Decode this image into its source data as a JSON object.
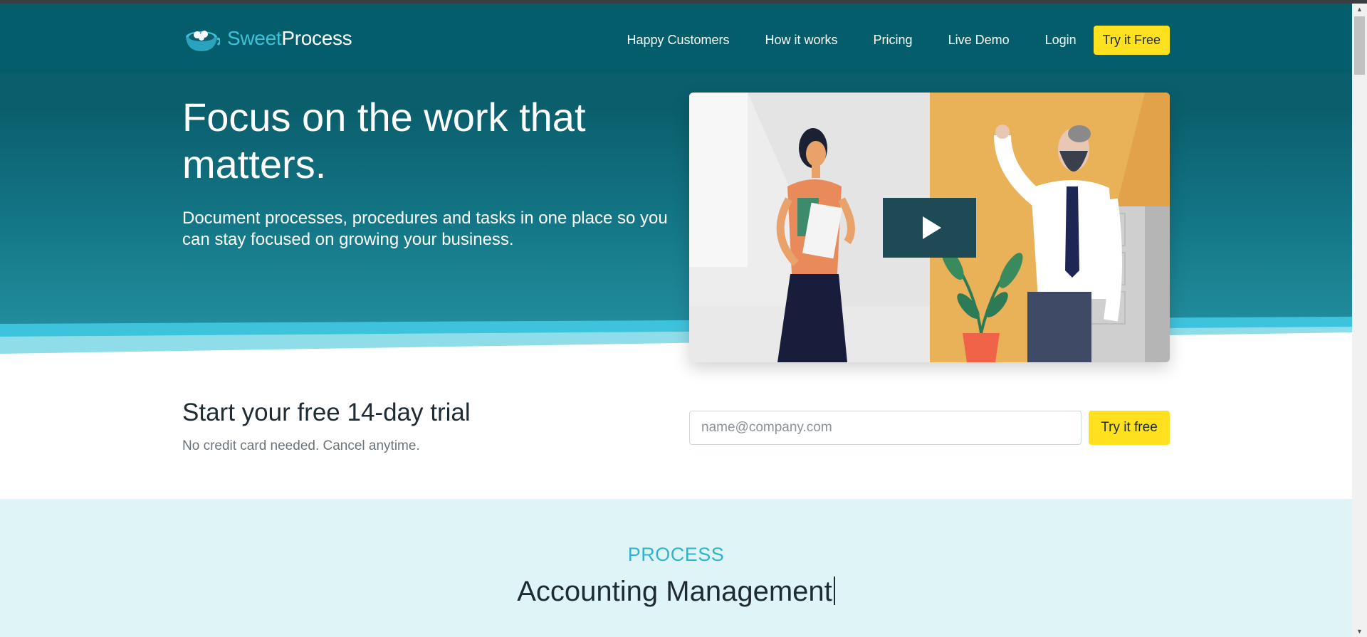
{
  "brand": {
    "name_part1": "Sweet",
    "name_part2": "Process",
    "logo_icon": "teacup-icon"
  },
  "nav": {
    "links": [
      "Happy Customers",
      "How it works",
      "Pricing",
      "Live Demo",
      "Login"
    ],
    "cta": "Try it Free"
  },
  "hero": {
    "title": "Focus on the work that matters.",
    "subtitle": "Document processes, procedures and tasks in one place so you can stay focused on growing your business.",
    "video_icon": "play-icon"
  },
  "trial": {
    "title": "Start your free 14-day trial",
    "note": "No credit card needed. Cancel anytime.",
    "email_placeholder": "name@company.com",
    "cta": "Try it free"
  },
  "process_section": {
    "kicker": "PROCESS",
    "title": "Accounting Management"
  },
  "colors": {
    "hero_dark": "#045d6b",
    "accent_cyan": "#3fc0d8",
    "cta_yellow": "#ffe11f",
    "section_bg": "#dff4f7"
  }
}
